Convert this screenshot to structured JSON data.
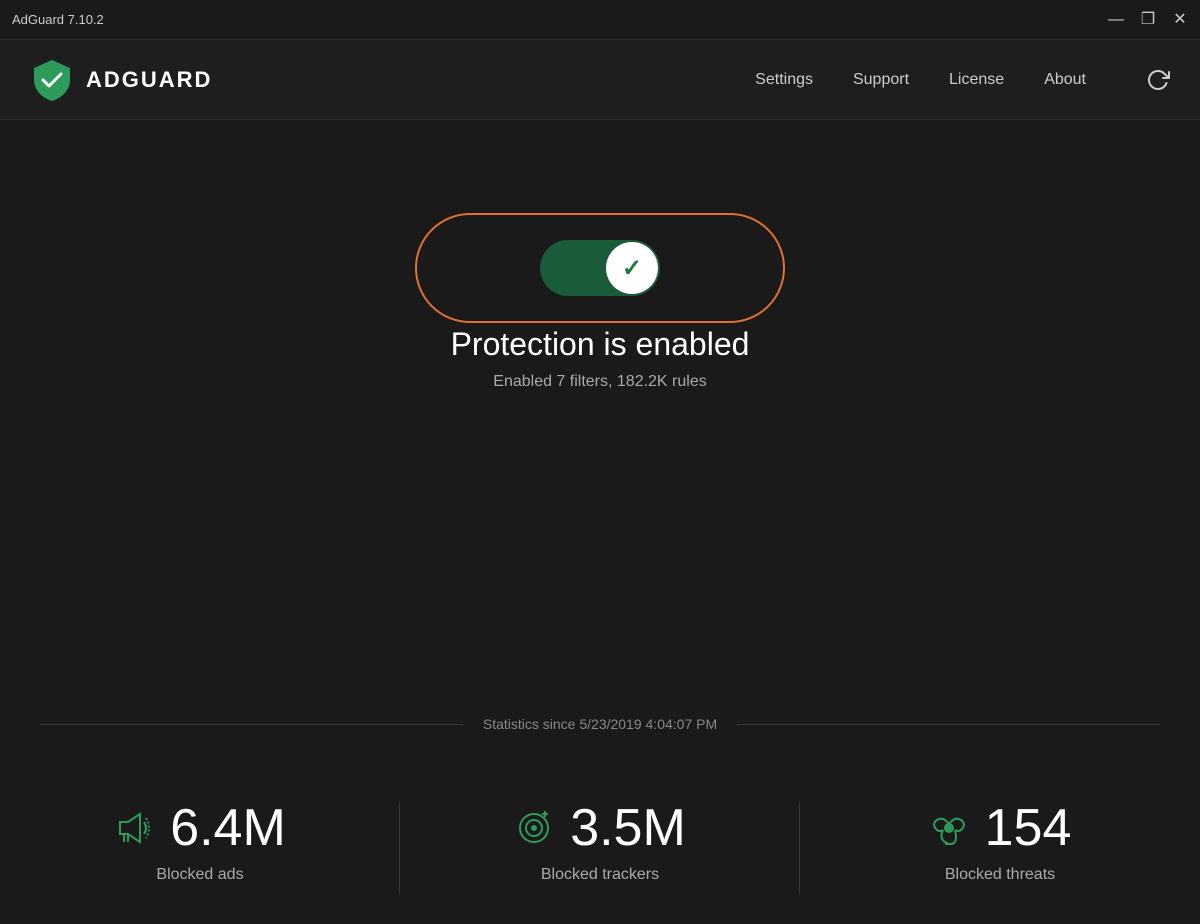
{
  "titlebar": {
    "title": "AdGuard 7.10.2",
    "minimize": "—",
    "maximize": "❐",
    "close": "✕"
  },
  "header": {
    "logo_text": "ADGUARD",
    "nav": {
      "settings": "Settings",
      "support": "Support",
      "license": "License",
      "about": "About"
    }
  },
  "protection": {
    "status_title": "Protection is enabled",
    "status_subtitle": "Enabled 7 filters, 182.2K rules",
    "toggle_enabled": true
  },
  "statistics": {
    "since_text": "Statistics since 5/23/2019 4:04:07 PM",
    "cards": [
      {
        "icon": "megaphone",
        "number": "6.4M",
        "label": "Blocked ads"
      },
      {
        "icon": "tracker",
        "number": "3.5M",
        "label": "Blocked trackers"
      },
      {
        "icon": "biohazard",
        "number": "154",
        "label": "Blocked threats"
      }
    ]
  }
}
